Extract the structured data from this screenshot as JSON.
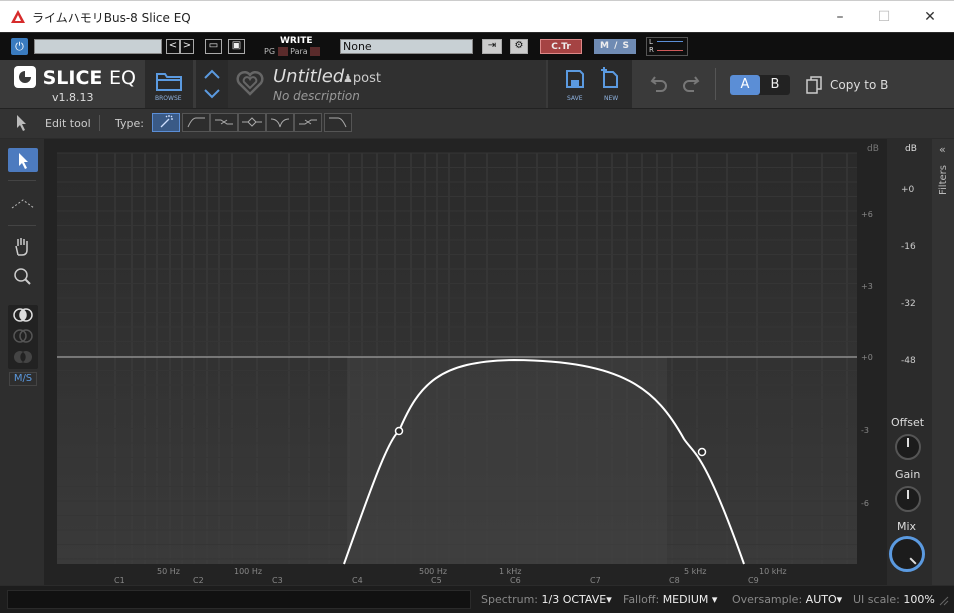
{
  "window": {
    "title": "ライムハモリBus-8 Slice EQ"
  },
  "host": {
    "write": "WRITE",
    "pg": "PG",
    "para": "Para",
    "preset_value": "None",
    "ctr": "C.Tr",
    "ms": "M / S",
    "l": "L",
    "r": "R"
  },
  "header": {
    "brand": "SLICE",
    "brand2": "EQ",
    "version": "v1.8.13",
    "browse": "BROWSE",
    "preset_name": "Untitled",
    "author": "post",
    "description": "No description",
    "save": "SAVE",
    "new": "NEW",
    "a": "A",
    "b": "B",
    "copy": "Copy to B"
  },
  "toolbar": {
    "edit_tool": "Edit tool",
    "type": "Type:"
  },
  "left": {
    "ms": "M/S"
  },
  "graph": {
    "db_scale_label": "dB",
    "db_ticks": [
      "+6",
      "+3",
      "+0",
      "-3",
      "-6"
    ],
    "freq_labels": [
      "50 Hz",
      "100 Hz",
      "500 Hz",
      "1 kHz",
      "5 kHz",
      "10 kHz"
    ],
    "note_labels": [
      "C1",
      "C2",
      "C3",
      "C4",
      "C5",
      "C6",
      "C7",
      "C8",
      "C9"
    ]
  },
  "right": {
    "db": "dB",
    "spectrum_ticks": [
      "+0",
      "-16",
      "-32",
      "-48"
    ],
    "offset": "Offset",
    "gain": "Gain",
    "mix": "Mix",
    "filters": "Filters"
  },
  "status": {
    "spectrum_label": "Spectrum:",
    "spectrum_value": "1/3 OCTAVE",
    "falloff_label": "Falloff:",
    "falloff_value": "MEDIUM",
    "oversample_label": "Oversample:",
    "oversample_value": "AUTO",
    "uiscale_label": "UI scale:",
    "uiscale_value": "100%"
  }
}
